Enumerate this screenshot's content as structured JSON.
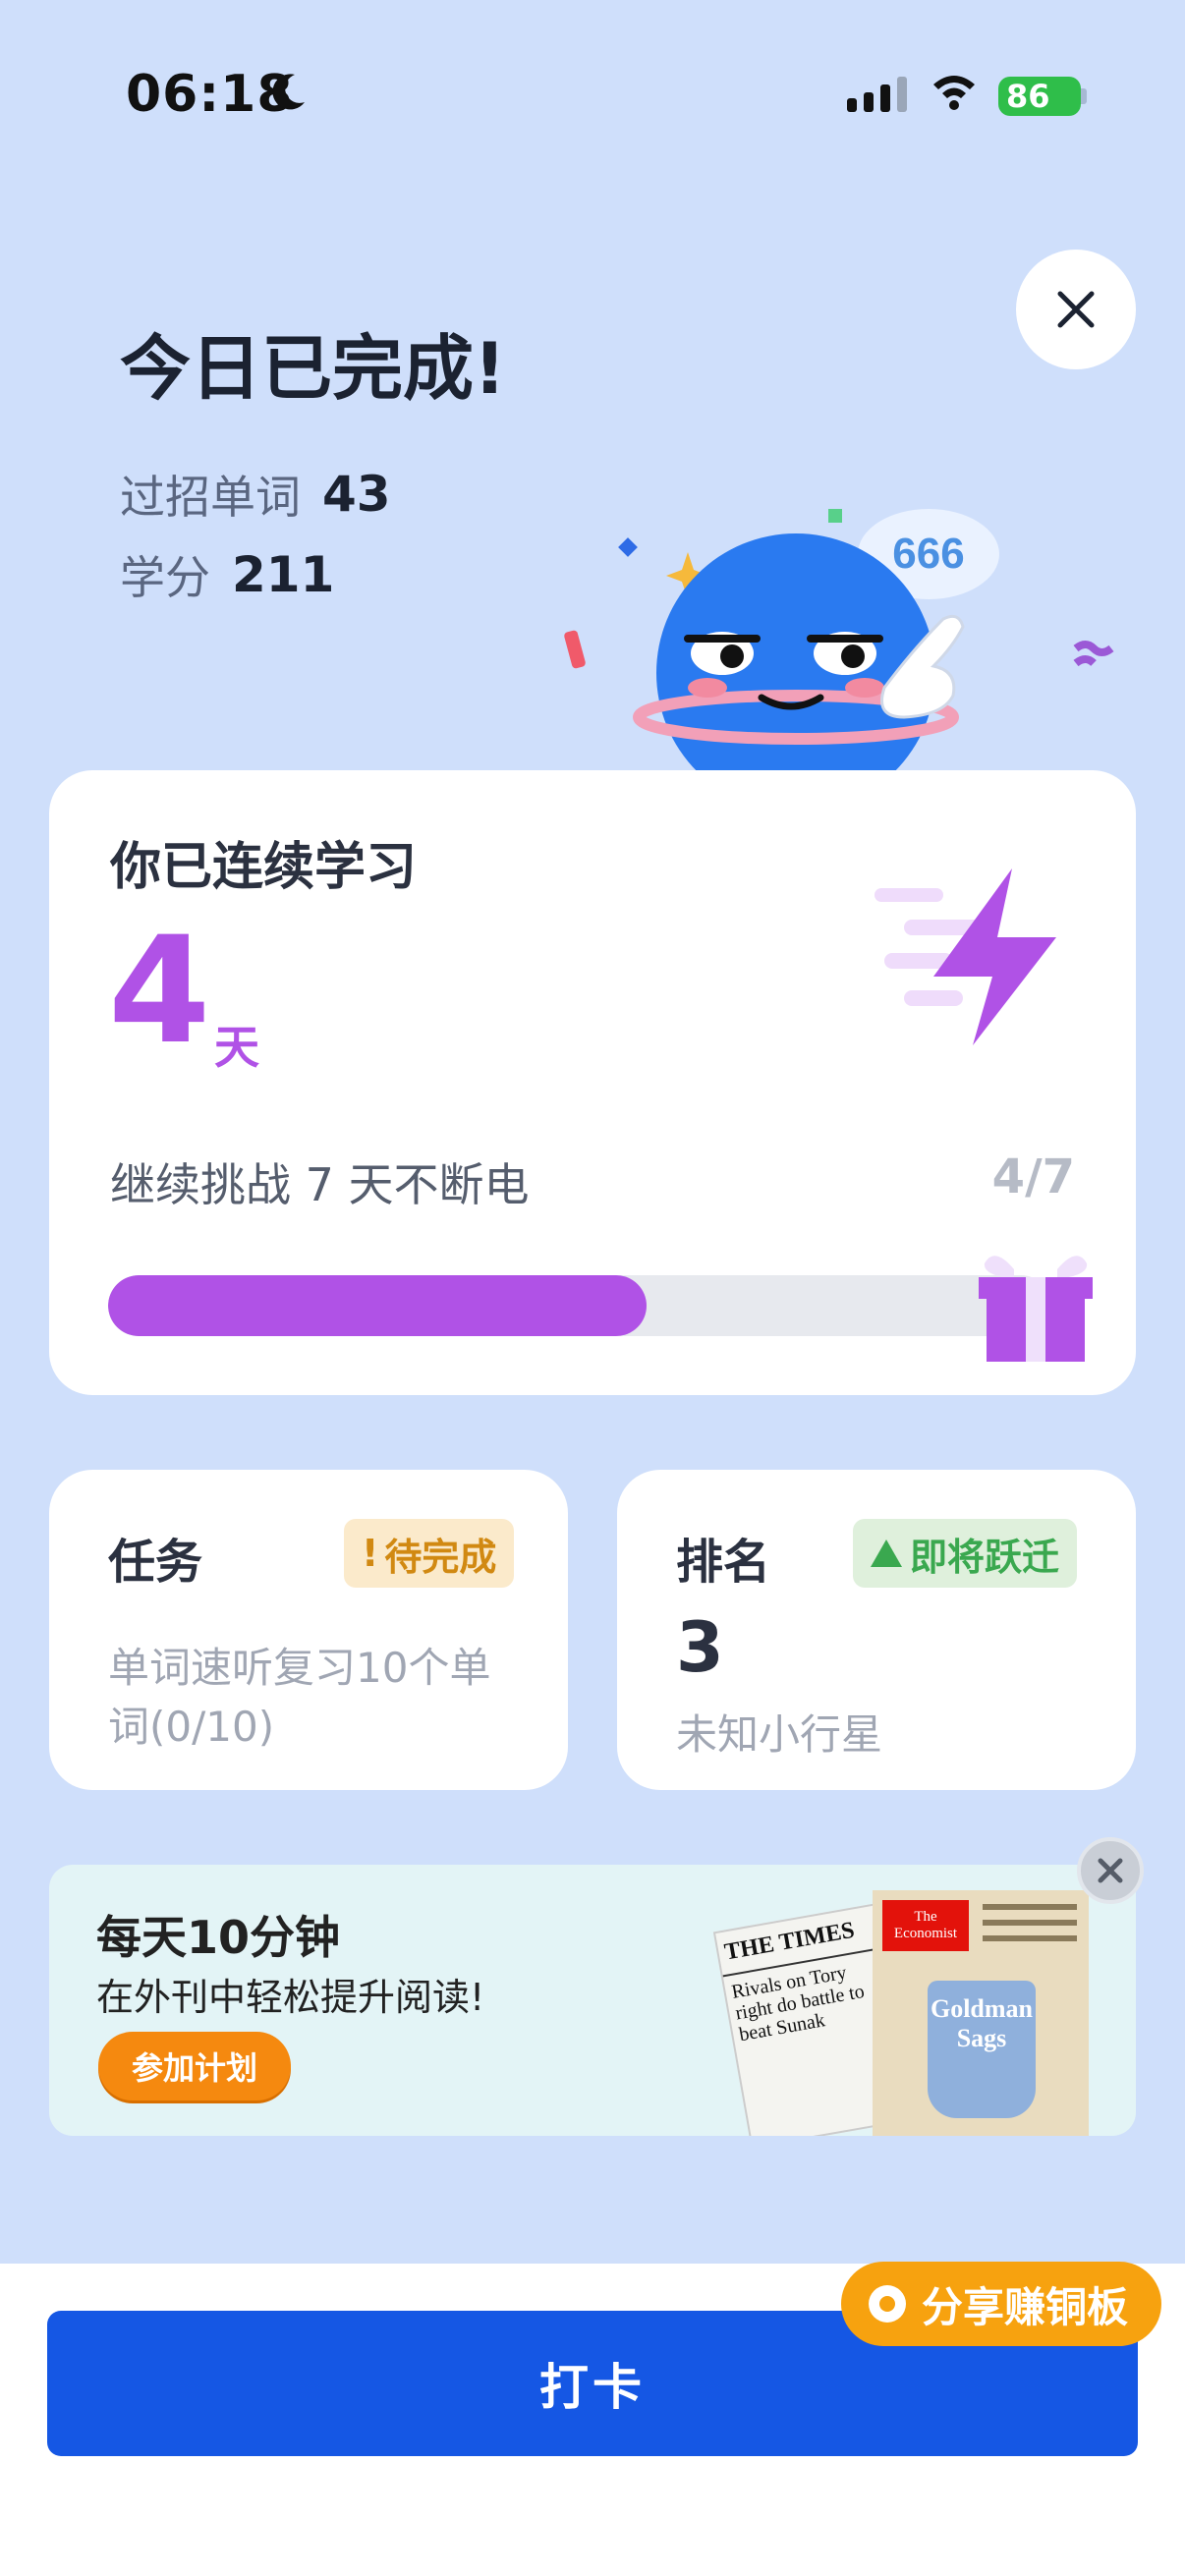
{
  "status_bar": {
    "time": "06:18",
    "battery": "86"
  },
  "header": {
    "title": "今日已完成!",
    "stats": [
      {
        "label": "过招单词",
        "value": "43"
      },
      {
        "label": "学分",
        "value": "211"
      }
    ],
    "bubble_text": "666"
  },
  "streak": {
    "title": "你已连续学习",
    "days": "4",
    "unit": "天",
    "challenge": "继续挑战 7 天不断电",
    "progress_text": "4/7",
    "progress_fraction": 0.571,
    "accent_color": "#b052e6"
  },
  "task": {
    "title": "任务",
    "badge": "待完成",
    "badge_mark": "!",
    "description": "单词速听复习10个单词(0/10)"
  },
  "rank": {
    "title": "排名",
    "badge": "即将跃迁",
    "value": "3",
    "subtitle": "未知小行星"
  },
  "ad": {
    "title": "每天10分钟",
    "subtitle": "在外刊中轻松提升阅读!",
    "button": "参加计划",
    "images": [
      {
        "masthead": "THE TIMES",
        "headline": "Rivals on Tory right do battle to beat Sunak"
      },
      {
        "masthead": "The Economist",
        "cover": "Goldman Sags"
      }
    ]
  },
  "share_button": "分享赚铜板",
  "checkin_button": "打卡",
  "colors": {
    "primary": "#1557e4",
    "background": "#cfdffb",
    "orange": "#f7a20f"
  }
}
